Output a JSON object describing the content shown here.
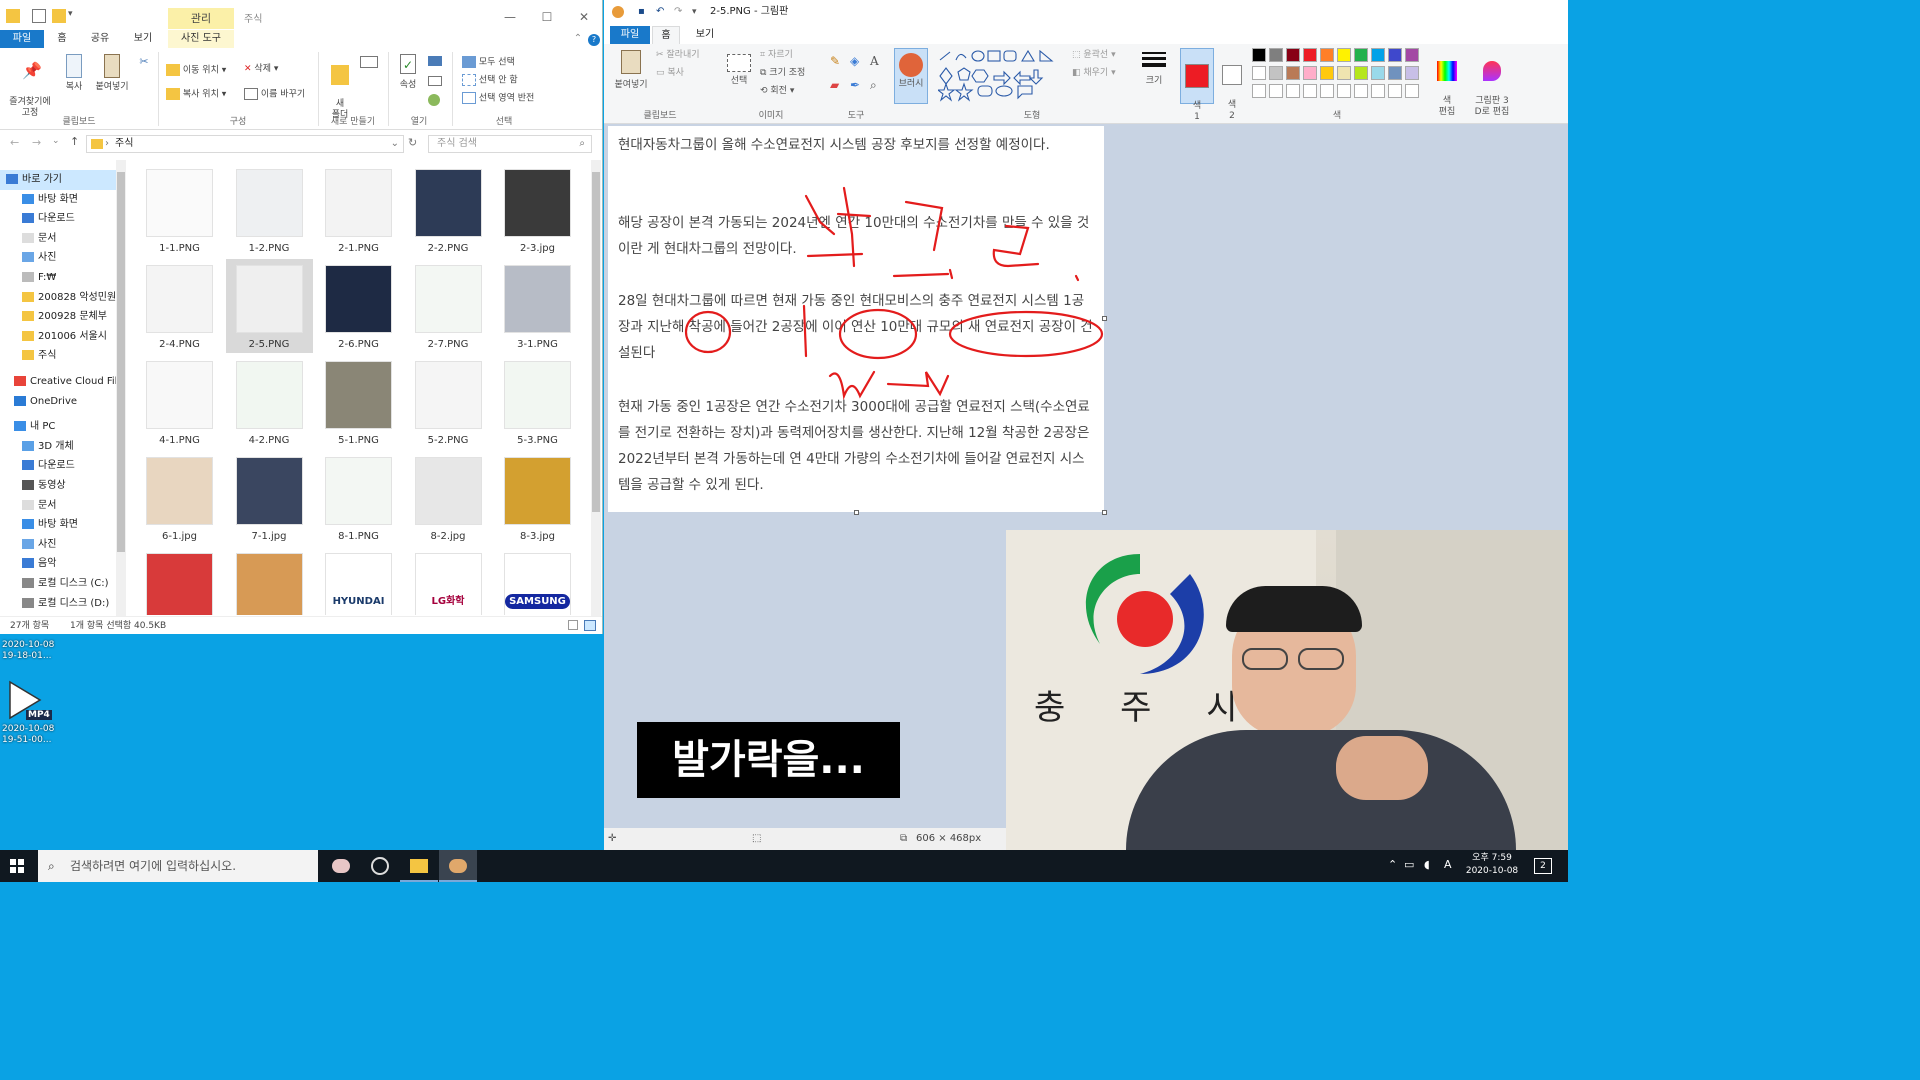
{
  "explorer": {
    "ctx_tab": "관리",
    "title": "주식",
    "tabs": [
      "파일",
      "홈",
      "공유",
      "보기",
      "사진 도구"
    ],
    "ribbon": {
      "pin": "즐겨찾기에\n고정",
      "copy": "복사",
      "paste": "붙여넣기",
      "move_to": "이동 위치",
      "copy_to": "복사 위치",
      "delete": "삭제",
      "rename": "이름 바꾸기",
      "new_folder": "새\n폴더",
      "properties": "속성",
      "select_all": "모두 선택",
      "select_none": "선택 안 함",
      "invert_selection": "선택 영역 반전",
      "groups": [
        "클립보드",
        "구성",
        "새로 만들기",
        "열기",
        "선택"
      ]
    },
    "address": "주식",
    "search_placeholder": "주식 검색",
    "nav": [
      {
        "label": "바로 가기",
        "icon": "star-icon"
      },
      {
        "label": "바탕 화면",
        "icon": "desktop-icon"
      },
      {
        "label": "다운로드",
        "icon": "download-icon"
      },
      {
        "label": "문서",
        "icon": "document-icon"
      },
      {
        "label": "사진",
        "icon": "picture-icon"
      },
      {
        "label": "F:₩",
        "icon": "drive-icon"
      },
      {
        "label": "200828 악성민원",
        "icon": "folder-icon"
      },
      {
        "label": "200928 문체부",
        "icon": "folder-icon"
      },
      {
        "label": "201006 서울시",
        "icon": "folder-icon"
      },
      {
        "label": "주식",
        "icon": "folder-icon"
      },
      {
        "label": "Creative Cloud Files",
        "icon": "creative-cloud-icon"
      },
      {
        "label": "OneDrive",
        "icon": "cloud-icon"
      },
      {
        "label": "내 PC",
        "icon": "pc-icon"
      },
      {
        "label": "3D 개체",
        "icon": "cube-icon"
      },
      {
        "label": "다운로드",
        "icon": "download-icon"
      },
      {
        "label": "동영상",
        "icon": "video-icon"
      },
      {
        "label": "문서",
        "icon": "document-icon"
      },
      {
        "label": "바탕 화면",
        "icon": "desktop-icon"
      },
      {
        "label": "사진",
        "icon": "picture-icon"
      },
      {
        "label": "음악",
        "icon": "music-icon"
      },
      {
        "label": "로컬 디스크 (C:)",
        "icon": "disk-icon"
      },
      {
        "label": "로컬 디스크 (D:)",
        "icon": "disk-icon"
      }
    ],
    "files": [
      "1-1.PNG",
      "1-2.PNG",
      "2-1.PNG",
      "2-2.PNG",
      "2-3.jpg",
      "2-4.PNG",
      "2-5.PNG",
      "2-6.PNG",
      "2-7.PNG",
      "3-1.PNG",
      "4-1.PNG",
      "4-2.PNG",
      "5-1.PNG",
      "5-2.PNG",
      "5-3.PNG",
      "6-1.jpg",
      "7-1.jpg",
      "8-1.PNG",
      "8-2.jpg",
      "8-3.jpg"
    ],
    "selected_file": "2-5.PNG",
    "bottom_brands": [
      "HYUNDAI MOBIS",
      "LG화학",
      "SAMSUNG"
    ],
    "status_count": "27개 항목",
    "status_selected": "1개 항목 선택함 40.5KB"
  },
  "paint": {
    "title": "2-5.PNG - 그림판",
    "tabs": [
      "파일",
      "홈",
      "보기"
    ],
    "ribbon": {
      "paste": "붙여넣기",
      "cut": "잘라내기",
      "copy": "복사",
      "select": "선택",
      "crop": "자르기",
      "resize": "크기 조정",
      "rotate": "회전",
      "brush": "브러시",
      "size": "크기",
      "color1": "색\n1",
      "color2": "색\n2",
      "edit_colors": "색\n편집",
      "paint3d": "그림판 3\nD로 편집",
      "outline": "윤곽선",
      "fill": "채우기",
      "groups": [
        "클립보드",
        "이미지",
        "도구",
        "도형",
        "색"
      ]
    },
    "text": [
      "현대자동차그룹이 올해 수소연료전지 시스템 공장 후보지를 선정할 예정이다.",
      "해당 공장이 본격 가동되는 2024년엔 연간 10만대의 수소전기차를 만들 수 있을 것이란 게 현대차그룹의 전망이다.",
      "28일 현대차그룹에 따르면 현재 가동 중인 현대모비스의 충주 연료전지 시스템 1공장과 지난해 착공에 들어간 2공장에 이어 연산 10만대 규모의 새 연료전지 공장이 건설된다",
      "현재 가동 중인 1공장은 연간 수소전기차 3000대에 공급할 연료전지 스택(수소연료를 전기로 전환하는 장치)과 동력제어장치를 생산한다. 지난해 12월 착공한 2공장은 2022년부터 본격 가동하는데 연 4만대 가량의 수소전기차에 들어갈 연료전지 시스템을 공급할 수 있게 된다."
    ],
    "status_size": "606 × 468px",
    "palette": [
      "#000000",
      "#7f7f7f",
      "#880015",
      "#ed1c24",
      "#ff7f27",
      "#fff200",
      "#22b14c",
      "#00a2e8",
      "#3f48cc",
      "#a349a4",
      "#ffffff",
      "#c3c3c3",
      "#b97a57",
      "#ffaec9",
      "#ffc90e",
      "#efe4b0",
      "#b5e61d",
      "#99d9ea",
      "#7092be",
      "#c8bfe7"
    ],
    "color1": "#ed1c24",
    "color2": "#ffffff"
  },
  "webcam": {
    "sign_text": [
      "충",
      "주",
      "시"
    ]
  },
  "caption": "발가락을...",
  "desktop": {
    "icon1_time": "2020-10-08\n19-18-01...",
    "icon2_label": "MP4",
    "icon2_time": "2020-10-08\n19-51-00..."
  },
  "taskbar": {
    "search_placeholder": "검색하려면 여기에 입력하십시오.",
    "clock_time": "오후 7:59",
    "clock_date": "2020-10-08",
    "ime": "A",
    "notifications": "2"
  }
}
